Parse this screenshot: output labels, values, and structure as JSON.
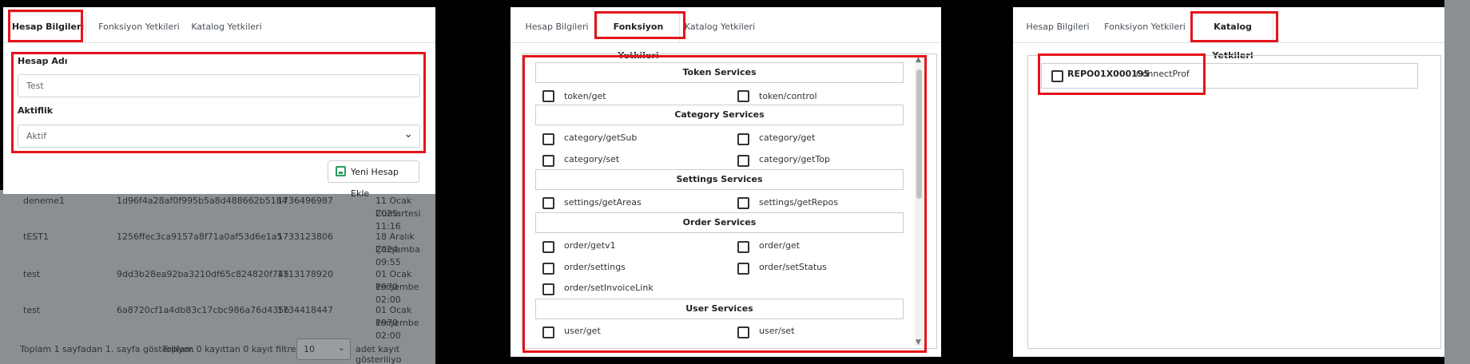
{
  "background_table": {
    "rows": [
      {
        "name": "deneme1",
        "key": "1d96f4a28af0f995b5a8d488662b5184",
        "code": "1736496987",
        "date": "11 Ocak 2025",
        "day": "Cumartesi 11:16"
      },
      {
        "name": "tEST1",
        "key": "1256ffec3ca9157a8f71a0af53d6e1a5",
        "code": "1733123806",
        "date": "18 Aralık 2024",
        "day": "Çarşamba 09:55"
      },
      {
        "name": "test",
        "key": "9dd3b28ea92ba3210df65c824820f745",
        "code": "1713178920",
        "date": "01 Ocak 1970",
        "day": "Perşembe 02:00"
      },
      {
        "name": "test",
        "key": "6a8720cf1a4db83c17cbc986a76d435b",
        "code": "1734418447",
        "date": "01 Ocak 1970",
        "day": "Perşembe 02:00"
      }
    ],
    "footer_info": "Toplam 1 sayfadan 1. sayfa gösteriliyor.",
    "footer_total": "Toplam 0 kayıttan 0 kayıt filtrelendi.",
    "page_size": "10",
    "footer_suffix": "adet kayıt gösteriliyo"
  },
  "tabs": {
    "account": "Hesap Bilgileri",
    "functions": "Fonksiyon Yetkileri",
    "catalog": "Katalog Yetkileri"
  },
  "panel1": {
    "account_name_label": "Hesap Adı",
    "account_name_value": "Test",
    "status_label": "Aktiflik",
    "status_value": "Aktif",
    "add_button": "Yeni Hesap Ekle"
  },
  "panel2": {
    "groups": [
      {
        "title": "Token Services",
        "items": [
          "token/get",
          "token/control"
        ]
      },
      {
        "title": "Category Services",
        "items": [
          "category/getSub",
          "category/get",
          "category/set",
          "category/getTop"
        ]
      },
      {
        "title": "Settings Services",
        "items": [
          "settings/getAreas",
          "settings/getRepos"
        ]
      },
      {
        "title": "Order Services",
        "items": [
          "order/getv1",
          "order/get",
          "order/settings",
          "order/setStatus",
          "order/setInvoiceLink"
        ]
      },
      {
        "title": "User Services",
        "items": [
          "user/get",
          "user/set"
        ]
      }
    ]
  },
  "panel3": {
    "repo_code": "REPO01X000195",
    "repo_name": "ConnectProf"
  }
}
